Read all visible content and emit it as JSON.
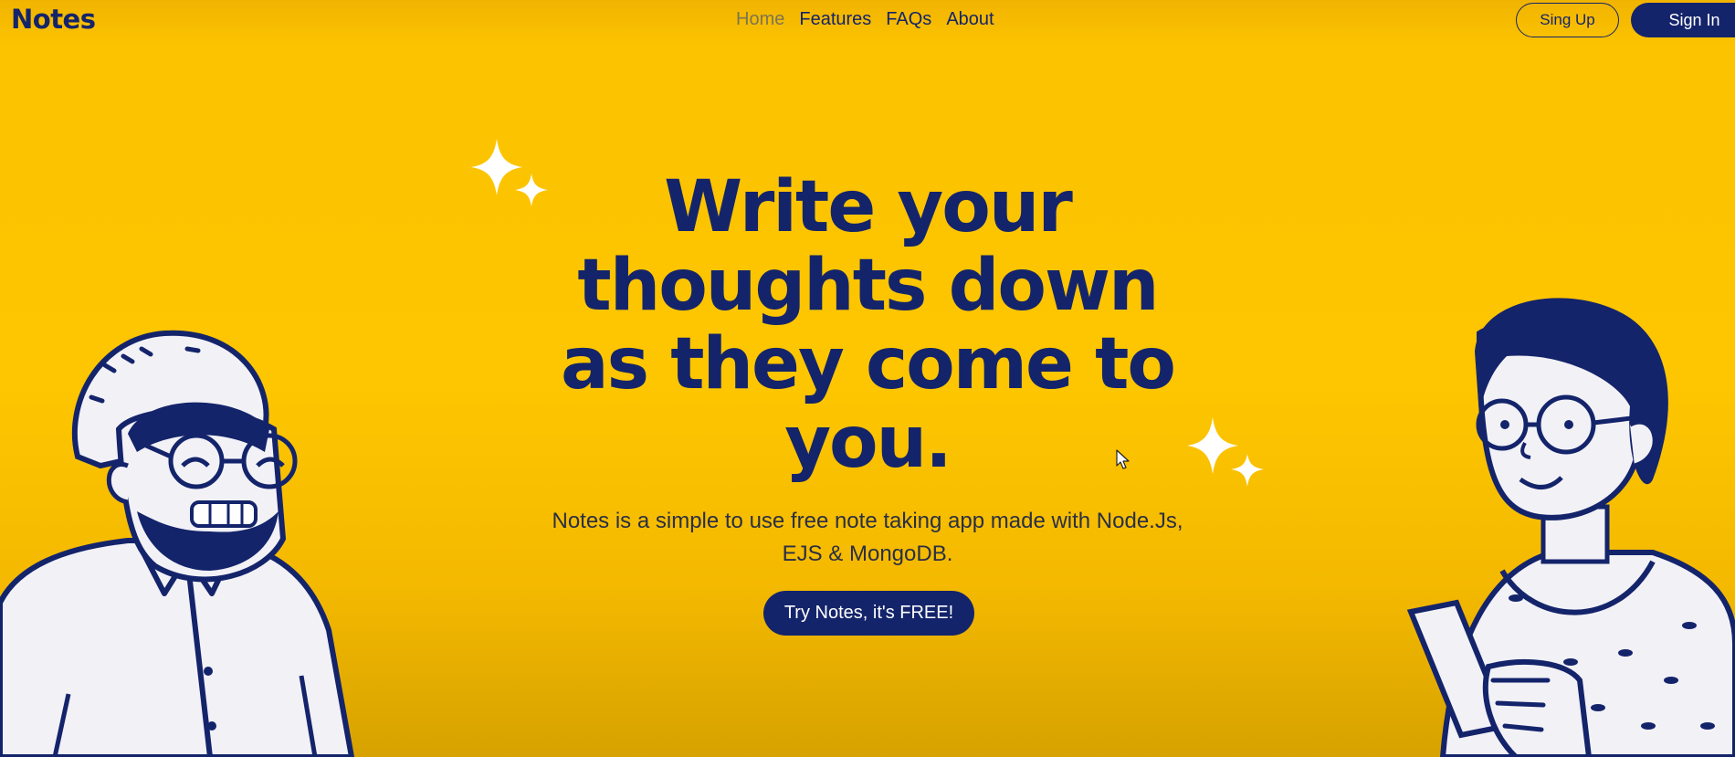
{
  "brand": {
    "name": "Notes"
  },
  "nav": {
    "items": [
      {
        "label": "Home",
        "active": true
      },
      {
        "label": "Features",
        "active": false
      },
      {
        "label": "FAQs",
        "active": false
      },
      {
        "label": "About",
        "active": false
      }
    ]
  },
  "auth": {
    "signup_label": "Sing Up",
    "signin_label": "Sign In"
  },
  "hero": {
    "title_lines": [
      "Write your",
      "thoughts down",
      "as they come to",
      "you."
    ],
    "subtitle_lines": [
      "Notes is a simple to use free note taking app made with Node.Js,",
      "EJS & MongoDB."
    ],
    "cta_label": "Try Notes, it's FREE!"
  },
  "icons": {
    "sparkles": "sparkle-icon",
    "left_person": "man-with-glasses-illustration",
    "right_person": "woman-with-phone-illustration",
    "cursor": "mouse-cursor-icon"
  },
  "colors": {
    "background": "#fdc600",
    "primary": "#14246b",
    "active_nav": "#7d7452",
    "white": "#ffffff"
  }
}
